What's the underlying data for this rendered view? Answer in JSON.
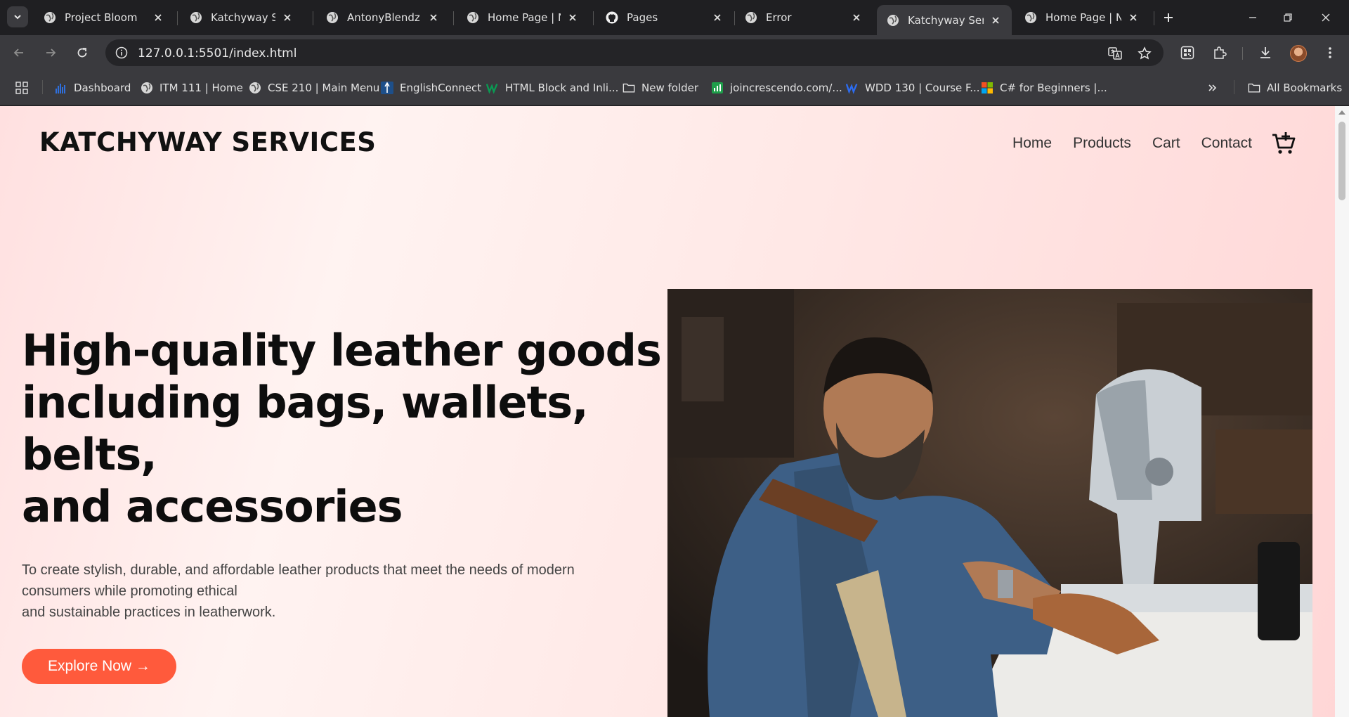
{
  "browser": {
    "tabs": [
      {
        "title": "Project Bloom",
        "favicon": "globe-icon"
      },
      {
        "title": "Katchyway Servic",
        "favicon": "globe-icon"
      },
      {
        "title": "AntonyBlendz",
        "favicon": "globe-icon"
      },
      {
        "title": "Home Page | Na",
        "favicon": "globe-icon"
      },
      {
        "title": "Pages",
        "favicon": "github-icon"
      },
      {
        "title": "Error",
        "favicon": "globe-icon"
      },
      {
        "title": "Katchyway Servic",
        "favicon": "globe-icon",
        "active": true
      },
      {
        "title": "Home Page | Na",
        "favicon": "globe-icon"
      }
    ],
    "url": "127.0.0.1:5501/index.html",
    "bookmarks": [
      {
        "label": "Dashboard",
        "icon": "bar-chart-icon"
      },
      {
        "label": "ITM 111 | Home",
        "icon": "globe-icon"
      },
      {
        "label": "CSE 210 | Main Menu",
        "icon": "globe-icon"
      },
      {
        "label": "EnglishConnect",
        "icon": "church-icon"
      },
      {
        "label": "HTML Block and Inli...",
        "icon": "w3-icon"
      },
      {
        "label": "New folder",
        "icon": "folder-icon"
      },
      {
        "label": "joincrescendo.com/...",
        "icon": "sheets-icon"
      },
      {
        "label": "WDD 130 | Course F...",
        "icon": "wdd-icon"
      },
      {
        "label": "C# for Beginners |...",
        "icon": "microsoft-icon"
      }
    ],
    "all_bookmarks": "All Bookmarks",
    "colors": {
      "chrome_dark": "#1f1f22",
      "chrome_toolbar": "#3a3a3e"
    }
  },
  "site": {
    "logo": "KATCHYWAY SERVICES",
    "nav": [
      "Home",
      "Products",
      "Cart",
      "Contact"
    ],
    "hero": {
      "title_lines": [
        "High-quality leather goods",
        "including bags, wallets,",
        "belts,",
        "and accessories"
      ],
      "subtitle_lines": [
        "To create stylish, durable, and affordable leather products that meet the needs of modern",
        "consumers while promoting ethical",
        "and sustainable practices in leatherwork."
      ],
      "cta": "Explore Now →"
    },
    "colors": {
      "accent": "#ff5a3c",
      "heading": "#0d0d0d",
      "background": "#ffe8e6"
    }
  }
}
